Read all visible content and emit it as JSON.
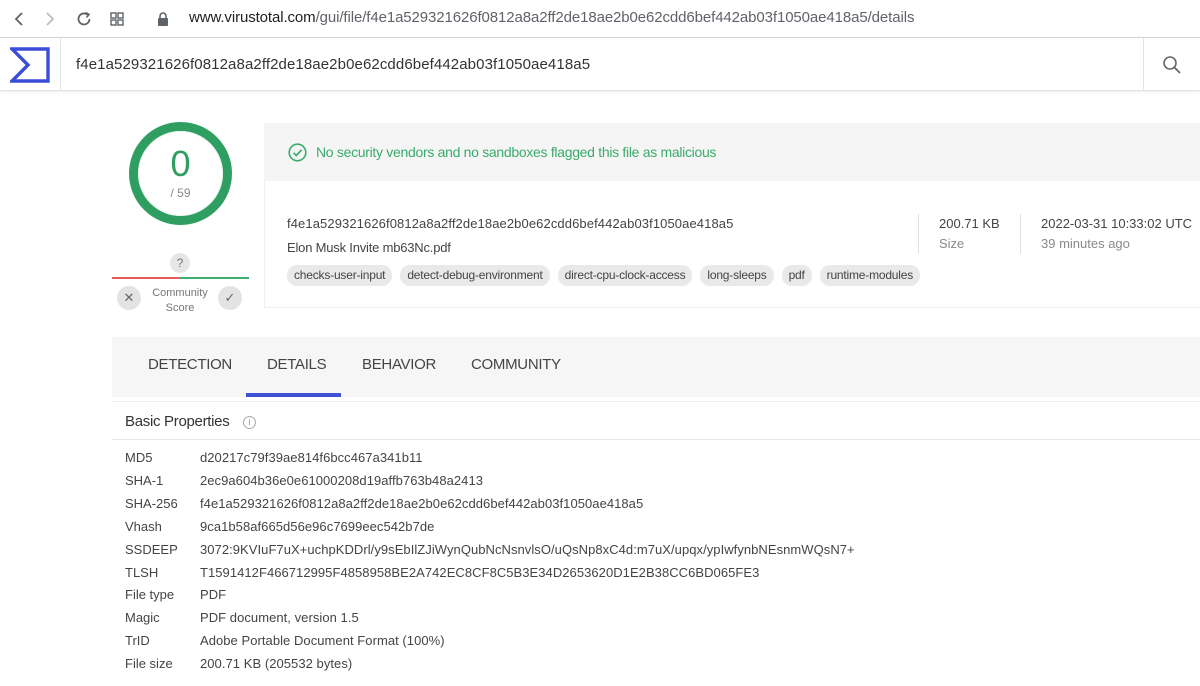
{
  "browser": {
    "url_host": "www.virustotal.com",
    "url_path": "/gui/file/f4e1a529321626f0812a8a2ff2de18ae2b0e62cdd6bef442ab03f1050ae418a5/details"
  },
  "header": {
    "search_value": "f4e1a529321626f0812a8a2ff2de18ae2b0e62cdd6bef442ab03f1050ae418a5"
  },
  "score": {
    "detections": "0",
    "total": "/ 59",
    "ring_color": "#2f9e61"
  },
  "community": {
    "score_symbol": "?",
    "label_line1": "Community",
    "label_line2": "Score",
    "down_symbol": "✕",
    "up_symbol": "✓"
  },
  "summary": {
    "status_text": "No security vendors and no sandboxes flagged this file as malicious",
    "status_color": "#3aab6c",
    "file_hash": "f4e1a529321626f0812a8a2ff2de18ae2b0e62cdd6bef442ab03f1050ae418a5",
    "file_name": "Elon Musk Invite mb63Nc.pdf",
    "tags": [
      "checks-user-input",
      "detect-debug-environment",
      "direct-cpu-clock-access",
      "long-sleeps",
      "pdf",
      "runtime-modules"
    ],
    "size_value": "200.71 KB",
    "size_label": "Size",
    "date_value": "2022-03-31 10:33:02 UTC",
    "date_ago": "39 minutes ago"
  },
  "tabs": {
    "detection": "DETECTION",
    "details": "DETAILS",
    "behavior": "BEHAVIOR",
    "community": "COMMUNITY",
    "active": "DETAILS",
    "accent_color": "#3f51d5"
  },
  "properties": {
    "title": "Basic Properties",
    "rows": [
      {
        "key": "MD5",
        "value": "d20217c79f39ae814f6bcc467a341b11"
      },
      {
        "key": "SHA-1",
        "value": "2ec9a604b36e0e61000208d19affb763b48a2413"
      },
      {
        "key": "SHA-256",
        "value": "f4e1a529321626f0812a8a2ff2de18ae2b0e62cdd6bef442ab03f1050ae418a5"
      },
      {
        "key": "Vhash",
        "value": "9ca1b58af665d56e96c7699eec542b7de"
      },
      {
        "key": "SSDEEP",
        "value": "3072:9KVIuF7uX+uchpKDDrl/y9sEbIlZJiWynQubNcNsnvlsO/uQsNp8xC4d:m7uX/upqx/ypIwfynbNEsnmWQsN7+"
      },
      {
        "key": "TLSH",
        "value": "T1591412F466712995F4858958BE2A742EC8CF8C5B3E34D2653620D1E2B38CC6BD065FE3"
      },
      {
        "key": "File type",
        "value": "PDF"
      },
      {
        "key": "Magic",
        "value": "PDF document, version 1.5"
      },
      {
        "key": "TrID",
        "value": "Adobe Portable Document Format (100%)"
      },
      {
        "key": "File size",
        "value": "200.71 KB (205532 bytes)"
      }
    ]
  }
}
